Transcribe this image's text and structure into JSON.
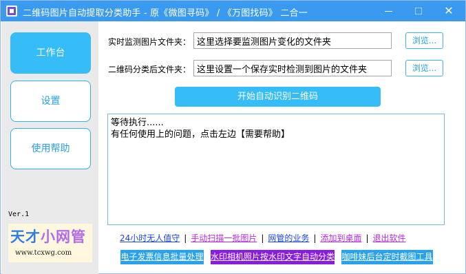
{
  "window": {
    "title": "二维码图片自动提取分类助手 - 原《微图寻码》 / 《万图找码》 二合一",
    "minimize_icon": "minimize-icon",
    "maximize_icon": "maximize-icon",
    "close_glyph": "✕"
  },
  "sidebar": {
    "items": [
      {
        "label": "工作台",
        "active": true
      },
      {
        "label": "设置",
        "active": false
      },
      {
        "label": "使用帮助",
        "active": false
      }
    ],
    "version": "Ver.1",
    "brand": {
      "name_part1": "天才",
      "name_part2": "小网管",
      "url": "www.tcxwg.com"
    }
  },
  "main": {
    "monitor_label": "实时监测图片文件夹：",
    "monitor_value": "这里选择要监测图片变化的文件夹",
    "output_label": "二维码分类后文件夹：",
    "output_value": "这里设置一个保存实时检测到图片的文件夹",
    "browse_label": "浏览...",
    "start_label": "开始自动识别二维码",
    "log_lines": [
      "等待执行......",
      "有任何使用上的问题，点击左边【需要帮助】"
    ]
  },
  "links": [
    {
      "label": "24小时无人值守",
      "color": "#1a46d8"
    },
    {
      "label": "手动扫描一批图片",
      "color": "#b62be0"
    },
    {
      "label": "网管的业务",
      "color": "#1a46d8"
    },
    {
      "label": "添加到桌面",
      "color": "#b62be0"
    },
    {
      "label": "退出软件",
      "color": "#b62be0"
    }
  ],
  "link_separator": "|",
  "promos": [
    {
      "label": "电子发票信息批量处理",
      "color": "#26a2f0"
    },
    {
      "label": "水印相机照片按水印文字自动分类",
      "color": "#8a1be0"
    },
    {
      "label": "咖啡妹后台定时截图工具",
      "color": "#26a2f0"
    }
  ],
  "colors": {
    "titlebar": "#3a9af0",
    "accent": "#36bdf8",
    "sidebar_bg": "#eaeaea"
  }
}
